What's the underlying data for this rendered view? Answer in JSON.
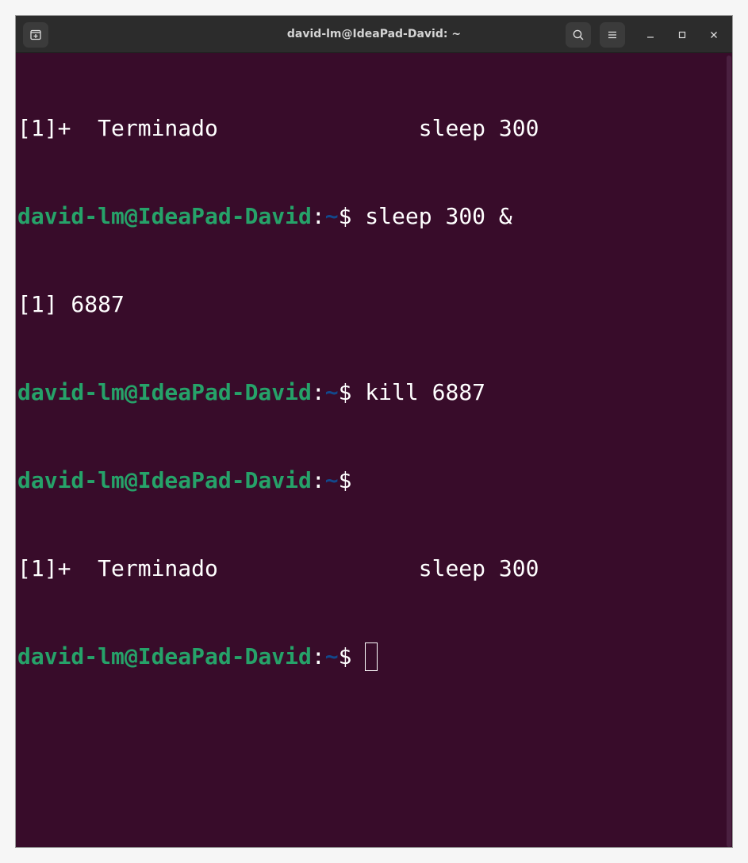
{
  "window": {
    "title": "david-lm@IdeaPad-David: ~"
  },
  "titlebar": {
    "new_tab_icon": "new-tab-icon",
    "search_icon": "search-icon",
    "menu_icon": "hamburger-menu-icon",
    "minimize_icon": "minimize-icon",
    "maximize_icon": "maximize-icon",
    "close_icon": "close-icon"
  },
  "colors": {
    "background": "#380c2a",
    "prompt_user": "#26a269",
    "prompt_path": "#12488b",
    "text": "#ffffff"
  },
  "terminal": {
    "lines": [
      {
        "type": "output",
        "text": "[1]+  Terminado               sleep 300"
      },
      {
        "type": "prompt",
        "user": "david-lm@IdeaPad-David",
        "sep": ":",
        "path": "~",
        "symbol": "$",
        "command": " sleep 300 &"
      },
      {
        "type": "output",
        "text": "[1] 6887"
      },
      {
        "type": "prompt",
        "user": "david-lm@IdeaPad-David",
        "sep": ":",
        "path": "~",
        "symbol": "$",
        "command": " kill 6887"
      },
      {
        "type": "prompt",
        "user": "david-lm@IdeaPad-David",
        "sep": ":",
        "path": "~",
        "symbol": "$",
        "command": ""
      },
      {
        "type": "output",
        "text": "[1]+  Terminado               sleep 300"
      },
      {
        "type": "prompt",
        "user": "david-lm@IdeaPad-David",
        "sep": ":",
        "path": "~",
        "symbol": "$",
        "command": " ",
        "cursor": true
      }
    ]
  }
}
